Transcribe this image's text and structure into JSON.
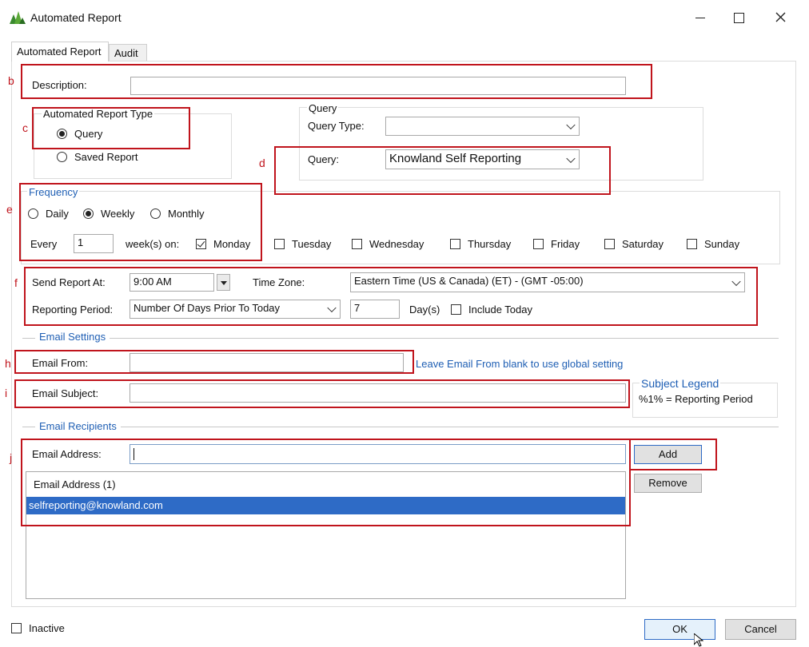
{
  "window": {
    "title": "Automated Report"
  },
  "tabs": [
    {
      "label": "Automated Report"
    },
    {
      "label": "Audit"
    }
  ],
  "description": {
    "label": "Description:",
    "value": ""
  },
  "report_type": {
    "title": "Automated Report Type",
    "options": [
      "Query",
      "Saved Report"
    ],
    "selected": "Query"
  },
  "query": {
    "title": "Query",
    "type_label": "Query Type:",
    "type_value": "",
    "query_label": "Query:",
    "query_value": "Knowland Self Reporting"
  },
  "frequency": {
    "title": "Frequency",
    "options": [
      "Daily",
      "Weekly",
      "Monthly"
    ],
    "selected": "Weekly",
    "every_label": "Every",
    "every_value": "1",
    "weeks_label": "week(s) on:",
    "days": [
      "Monday",
      "Tuesday",
      "Wednesday",
      "Thursday",
      "Friday",
      "Saturday",
      "Sunday"
    ],
    "checked_days": [
      "Monday"
    ]
  },
  "schedule": {
    "send_label": "Send Report At:",
    "send_value": "9:00 AM",
    "timezone_label": "Time Zone:",
    "timezone_value": "Eastern Time (US & Canada) (ET) - (GMT -05:00)",
    "period_label": "Reporting Period:",
    "period_value": "Number Of Days Prior To Today",
    "days_value": "7",
    "days_label": "Day(s)",
    "include_today_label": "Include Today"
  },
  "email_settings": {
    "title": "Email Settings",
    "from_label": "Email From:",
    "from_value": "",
    "from_hint": "Leave Email From blank to use global setting",
    "subject_label": "Email Subject:",
    "subject_value": "",
    "legend_title": "Subject Legend",
    "legend_text": "%1% = Reporting Period"
  },
  "recipients": {
    "title": "Email Recipients",
    "address_label": "Email Address:",
    "address_value": "",
    "add_label": "Add",
    "remove_label": "Remove",
    "list_header": "Email Address (1)",
    "list_items": [
      "selfreporting@knowland.com"
    ]
  },
  "footer": {
    "inactive_label": "Inactive",
    "ok_label": "OK",
    "cancel_label": "Cancel"
  },
  "annotations": {
    "b": "b",
    "c": "c",
    "d": "d",
    "e": "e",
    "f": "f",
    "h": "h",
    "i": "i",
    "j": "j"
  },
  "colors": {
    "accent": "#1f5fb4",
    "selection": "#2e6bc6",
    "annotation": "#c0141c"
  }
}
